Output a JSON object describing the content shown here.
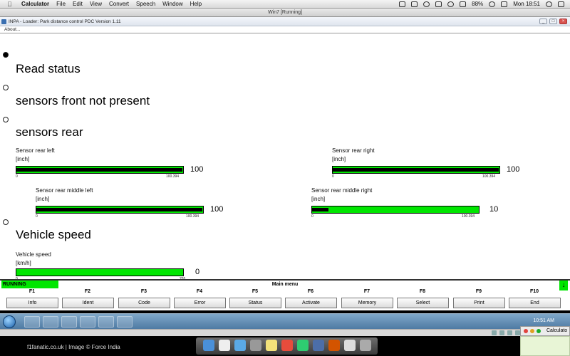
{
  "mac_menubar": {
    "app": "Calculator",
    "menus": [
      "Calculator",
      "File",
      "Edit",
      "View",
      "Convert",
      "Speech",
      "Window",
      "Help"
    ],
    "battery": "88%",
    "clock": "Mon 18:51"
  },
  "vm_window": {
    "title": "Win7 [Running]"
  },
  "inpa": {
    "title": "INPA - Loader:  Park distance control PDC Version 1.11",
    "menu_item": "About...",
    "sections": {
      "read_status": "Read status",
      "front": "sensors front not present",
      "rear": "sensors rear",
      "speed": "Vehicle speed"
    },
    "gauges": {
      "rear_left": {
        "label": "Sensor rear left",
        "unit": "[inch]",
        "min": "0",
        "max": "100.394",
        "value": "100",
        "fraction": 0.996
      },
      "rear_right": {
        "label": "Sensor rear right",
        "unit": "[inch]",
        "min": "0",
        "max": "100.394",
        "value": "100",
        "fraction": 0.996
      },
      "rear_middle_left": {
        "label": "Sensor rear middle left",
        "unit": "[inch]",
        "min": "0",
        "max": "100.394",
        "value": "100",
        "fraction": 0.996
      },
      "rear_middle_right": {
        "label": "Sensor rear middle right",
        "unit": "[inch]",
        "min": "0",
        "max": "100.394",
        "value": "10",
        "fraction": 0.1
      },
      "vehicle_speed": {
        "label": "Vehicle speed",
        "unit": "[km/h]",
        "min": "0",
        "max": "255",
        "value": "0",
        "fraction": 0
      }
    },
    "status": "RUNNING",
    "main_menu": "Main menu",
    "fkeys": [
      {
        "key": "F1",
        "label": "Info"
      },
      {
        "key": "F2",
        "label": "Ident"
      },
      {
        "key": "F3",
        "label": "Code"
      },
      {
        "key": "F4",
        "label": "Error"
      },
      {
        "key": "F5",
        "label": "Status"
      },
      {
        "key": "F6",
        "label": "Activate"
      },
      {
        "key": "F7",
        "label": "Memory"
      },
      {
        "key": "F8",
        "label": "Select"
      },
      {
        "key": "F9",
        "label": "Print"
      },
      {
        "key": "F10",
        "label": "End"
      }
    ],
    "colors": {
      "bar_green": "#00e600",
      "fill_black": "#000000"
    }
  },
  "win_taskbar": {
    "clock": "10:51 AM"
  },
  "calculator_window": {
    "title": "Calculato"
  },
  "credit": "f1fanatic.co.uk | Image © Force India"
}
